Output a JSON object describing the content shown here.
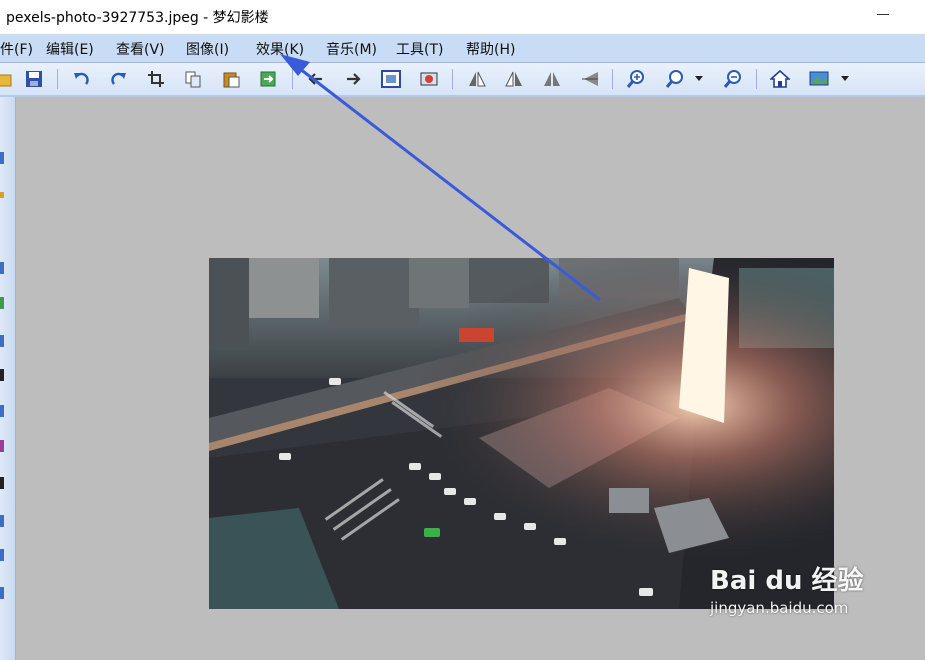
{
  "window": {
    "title": "pexels-photo-3927753.jpeg - 梦幻影楼",
    "minimize_label": "—"
  },
  "menu": [
    {
      "label": "件(F)"
    },
    {
      "label": "编辑(E)"
    },
    {
      "label": "查看(V)"
    },
    {
      "label": "图像(I)"
    },
    {
      "label": "效果(K)"
    },
    {
      "label": "音乐(M)"
    },
    {
      "label": "工具(T)"
    },
    {
      "label": "帮助(H)"
    }
  ],
  "toolbar": {
    "buttons": [
      {
        "icon": "open-folder-icon"
      },
      {
        "icon": "save-icon"
      },
      {
        "icon": "undo-icon"
      },
      {
        "icon": "redo-icon"
      },
      {
        "icon": "crop-icon"
      },
      {
        "icon": "copy-icon"
      },
      {
        "icon": "paste-icon"
      },
      {
        "icon": "export-icon"
      },
      {
        "icon": "previous-icon"
      },
      {
        "icon": "next-icon"
      },
      {
        "icon": "fit-window-icon"
      },
      {
        "icon": "slideshow-icon"
      },
      {
        "icon": "rotate-left-icon"
      },
      {
        "icon": "rotate-right-icon"
      },
      {
        "icon": "flip-horizontal-icon"
      },
      {
        "icon": "flip-vertical-icon"
      },
      {
        "icon": "zoom-in-icon"
      },
      {
        "icon": "zoom-icon"
      },
      {
        "icon": "zoom-out-icon"
      },
      {
        "icon": "home-icon"
      },
      {
        "icon": "wallpaper-icon"
      }
    ]
  },
  "image": {
    "description_name": "city-intersection-photo"
  },
  "watermark": {
    "logo": "Bai du 经验",
    "url": "jingyan.baidu.com"
  },
  "colors": {
    "accent_arrow": "#3a5bd9",
    "menubar": "#c8dcf6",
    "canvas": "#bdbdbd"
  }
}
